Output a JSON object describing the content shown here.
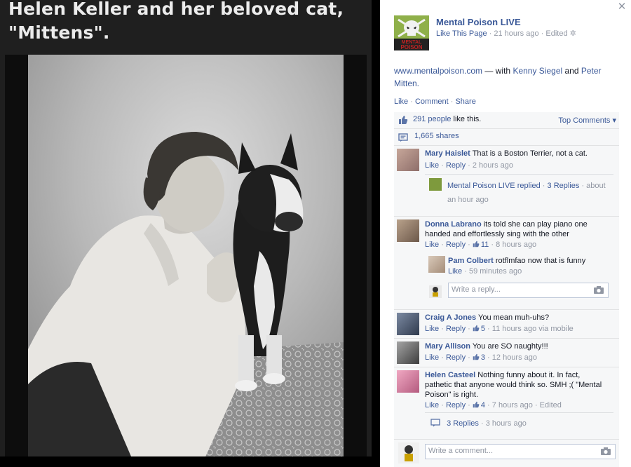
{
  "photo": {
    "caption_line1": "Helen Keller and her beloved cat,",
    "caption_line2": "\"Mittens\"."
  },
  "post": {
    "page_name": "Mental Poison LIVE",
    "like_page": "Like This Page",
    "time": "21 hours ago",
    "edited": "Edited",
    "avatar_text_line1": "MENTAL",
    "avatar_text_line2": "POISON",
    "link": "www.mentalpoison.com",
    "with_prefix": "— with",
    "with_name1": "Kenny Siegel",
    "with_and": "and",
    "with_name2": "Peter Mitten.",
    "actions": {
      "like": "Like",
      "comment": "Comment",
      "share": "Share"
    }
  },
  "ufi": {
    "likes_count": "291 people",
    "likes_suffix": "like this.",
    "top_comments": "Top Comments",
    "shares": "1,665 shares"
  },
  "comments": [
    {
      "author": "Mary Haislet",
      "text": "That is a Boston Terrier, not a cat.",
      "like": "Like",
      "reply": "Reply",
      "time": "2 hours ago",
      "reply_summary": {
        "author": "Mental Poison LIVE",
        "action": "replied",
        "replies": "3 Replies",
        "time": "about an hour ago"
      }
    },
    {
      "author": "Donna Labrano",
      "text": "its told she can play piano one handed and effortlessly sing with the other",
      "like": "Like",
      "reply": "Reply",
      "likes": "11",
      "time": "8 hours ago",
      "nested": {
        "author": "Pam Colbert",
        "text": "rotflmfao now that is funny",
        "like": "Like",
        "time": "59 minutes ago"
      },
      "reply_placeholder": "Write a reply..."
    },
    {
      "author": "Craig A Jones",
      "text": "You mean muh-uhs?",
      "like": "Like",
      "reply": "Reply",
      "likes": "5",
      "time": "11 hours ago via mobile"
    },
    {
      "author": "Mary Allison",
      "text": "You are SO naughty!!!",
      "like": "Like",
      "reply": "Reply",
      "likes": "3",
      "time": "12 hours ago"
    },
    {
      "author": "Helen Casteel",
      "text": "Nothing funny about it. In fact, pathetic that anyone would think so. SMH ;( \"Mental Poison\" is right.",
      "like": "Like",
      "reply": "Reply",
      "likes": "4",
      "time": "7 hours ago",
      "edited": "Edited",
      "replies": "3 Replies",
      "replies_time": "3 hours ago"
    }
  ],
  "composer": {
    "placeholder": "Write a comment..."
  },
  "colors": {
    "link": "#3b5998",
    "meta": "#9197a3",
    "ufi_bg": "#f6f7f8"
  }
}
